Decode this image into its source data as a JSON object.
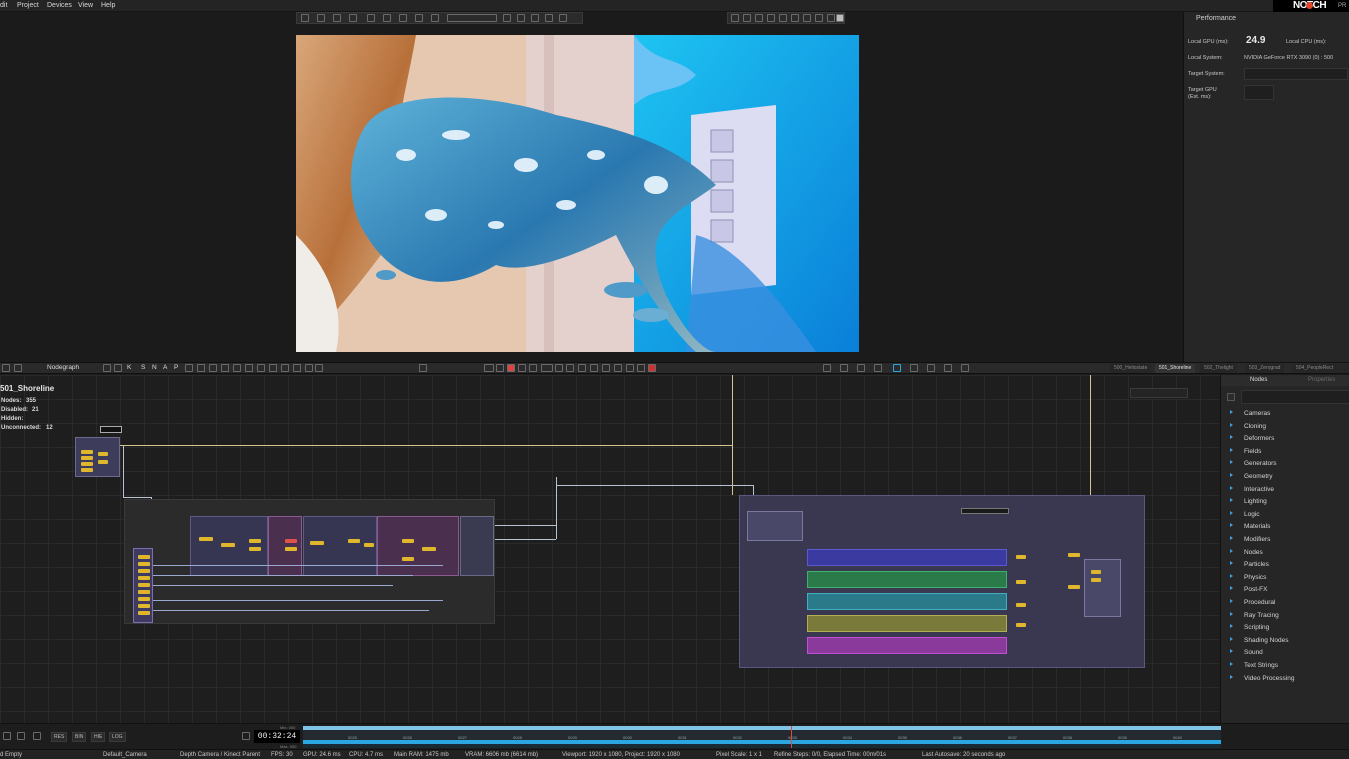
{
  "menu": [
    "dit",
    "Project",
    "Devices",
    "View",
    "Help"
  ],
  "brand": {
    "logo": "NOTCH",
    "edition": "PR"
  },
  "performance": {
    "title": "Performance",
    "local_gpu_label": "Local GPU (ms):",
    "local_gpu_value": "24.9",
    "local_cpu_label": "Local CPU (ms):",
    "local_system_label": "Local System:",
    "local_system_value": "NVIDIA GeForce RTX 3090 (0) : 500",
    "target_system_label": "Target System:",
    "target_gpu_label": "Target GPU",
    "target_gpu_sub": "(Est. ms):"
  },
  "nodegraph_toolbar": {
    "tab_label": "Nodegraph",
    "snap_letters": [
      "K",
      "S",
      "N",
      "A",
      "P"
    ],
    "scene_tabs": [
      "500_Heliostate",
      "501_Shoreline",
      "502_Thelight",
      "503_Zerograd",
      "504_PeopleRect"
    ],
    "active_scene": "501_Shoreline"
  },
  "nodegraph": {
    "title": "501_Shoreline",
    "nodes_label": "Nodes:",
    "nodes_value": "355",
    "disabled_label": "Disabled:",
    "disabled_value": "21",
    "hidden_label": "Hidden:",
    "hidden_value": "",
    "unconnected_label": "Unconnected:",
    "unconnected_value": "12"
  },
  "nodes_panel": {
    "tabs": [
      "Nodes",
      "Properties"
    ],
    "categories": [
      "Cameras",
      "Cloning",
      "Deformers",
      "Fields",
      "Generators",
      "Geometry",
      "Interactive",
      "Lighting",
      "Logic",
      "Materials",
      "Modifiers",
      "Nodes",
      "Particles",
      "Physics",
      "Post-FX",
      "Procedural",
      "Ray Tracing",
      "Scripting",
      "Shading Nodes",
      "Sound",
      "Text Strings",
      "Video Processing"
    ]
  },
  "timeline": {
    "buttons": [
      "RES",
      "BIN",
      "HIE",
      "LOG"
    ],
    "timecode": "00:32:24",
    "min_label": "Min: 000",
    "max_label": "Max: 000",
    "ticks": [
      "0025",
      "0026",
      "0027",
      "0028",
      "0029",
      "0030",
      "0031",
      "0032",
      "0033",
      "0034",
      "0035",
      "0036",
      "0037",
      "0038",
      "0039",
      "0040"
    ]
  },
  "status": {
    "layer": "d Empty",
    "camera": "Default_Camera",
    "parent": "Depth Camera / Kinect  Parent",
    "fps": "FPS: 30",
    "gpu": "GPU: 24.6 ms",
    "cpu": "CPU: 4.7 ms",
    "ram": "Main RAM: 1475 mb",
    "vram": "VRAM: 6606 mb (6614 mb)",
    "viewport": "Viewport: 1920 x 1080, Project: 1920 x 1080",
    "pixel_scale": "Pixel Scale: 1 x 1",
    "refine": "Refine Steps: 0/0, Elapsed Time: 00m/01s",
    "autosave": "Last Autosave: 20 seconds ago"
  },
  "colors": {
    "accent": "#2ba6e0",
    "playhead": "#e04a3a",
    "logo_dot": "#e2462a"
  }
}
